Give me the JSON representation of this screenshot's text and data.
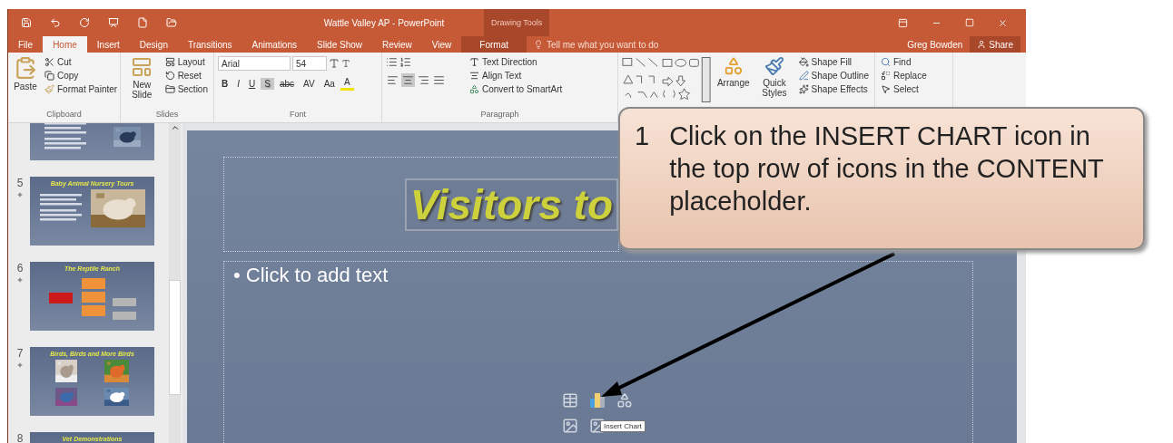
{
  "window": {
    "title": "Wattle Valley AP - PowerPoint",
    "contextual_title": "Drawing Tools"
  },
  "tabs": [
    {
      "label": "File",
      "selected": false,
      "contextual": false
    },
    {
      "label": "Home",
      "selected": true,
      "contextual": false
    },
    {
      "label": "Insert",
      "selected": false,
      "contextual": false
    },
    {
      "label": "Design",
      "selected": false,
      "contextual": false
    },
    {
      "label": "Transitions",
      "selected": false,
      "contextual": false
    },
    {
      "label": "Animations",
      "selected": false,
      "contextual": false
    },
    {
      "label": "Slide Show",
      "selected": false,
      "contextual": false
    },
    {
      "label": "Review",
      "selected": false,
      "contextual": false
    },
    {
      "label": "View",
      "selected": false,
      "contextual": false
    },
    {
      "label": "Format",
      "selected": false,
      "contextual": true
    }
  ],
  "tell_me": {
    "placeholder": "Tell me what you want to do"
  },
  "user": "Greg Bowden",
  "share": "Share",
  "ribbon": {
    "clipboard": {
      "paste": "Paste",
      "cut": "Cut",
      "copy": "Copy",
      "format_painter": "Format Painter",
      "label": "Clipboard"
    },
    "slides": {
      "new_slide": "New Slide",
      "layout": "Layout",
      "reset": "Reset",
      "section": "Section",
      "label": "Slides"
    },
    "font": {
      "font_name": "Arial",
      "font_size": "54",
      "label": "Font",
      "buttons": [
        {
          "label": "B",
          "selected": false
        },
        {
          "label": "I",
          "selected": false
        },
        {
          "label": "U",
          "selected": false
        },
        {
          "label": "S",
          "selected": true
        },
        {
          "label": "abc",
          "selected": false
        },
        {
          "label": "AV",
          "selected": false
        },
        {
          "label": "Aa",
          "selected": false
        },
        {
          "label": "A",
          "selected": false
        }
      ]
    },
    "paragraph": {
      "text_direction": "Text Direction",
      "align_text": "Align Text",
      "smartart": "Convert to SmartArt",
      "label": "Paragraph",
      "alignment": [
        {
          "selected": false
        },
        {
          "selected": true
        },
        {
          "selected": false
        },
        {
          "selected": false
        }
      ]
    },
    "drawing": {
      "arrange": "Arrange",
      "quick_styles": "Quick Styles",
      "shape_fill": "Shape Fill",
      "shape_outline": "Shape Outline",
      "shape_effects": "Shape Effects"
    },
    "editing": {
      "find": "Find",
      "replace": "Replace",
      "select": "Select"
    }
  },
  "thumbnails": [
    {
      "kind": "partial"
    },
    {
      "number": "5",
      "title": "Baby Animal Nursery Tours"
    },
    {
      "number": "6",
      "title": "The Reptile Ranch",
      "kind": "diagram"
    },
    {
      "number": "7",
      "title": "Birds, Birds and More Birds",
      "kind": "gallery"
    },
    {
      "number": "8",
      "title": "Vet Demonstrations",
      "kind": "cut"
    }
  ],
  "slide": {
    "title": "Visitors to",
    "body": "• Click to add text",
    "tooltip": "Insert Chart"
  },
  "callout": {
    "number": "1",
    "text": "Click on the INSERT CHART icon in the top row of icons in the CONTENT placeholder."
  }
}
